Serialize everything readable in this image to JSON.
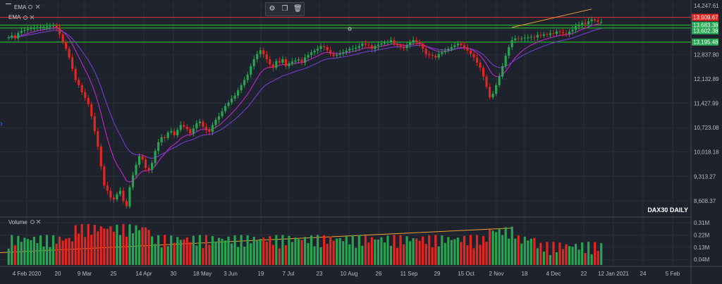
{
  "toolbar": {
    "icons": [
      "series-settings-icon",
      "copy-icon",
      "delete-icon"
    ]
  },
  "indicators": {
    "row1": "EMA",
    "row2": "EMA",
    "volume_label": "Volume"
  },
  "watermark": "DAX30 DAILY",
  "colors": {
    "background": "#1e222d",
    "grid": "#2a2e39",
    "up": "#26a650",
    "down": "#e3261f",
    "ema_fast": "#d226d8",
    "ema_slow": "#7b3fd9",
    "trend": "#f0a030",
    "hline": "#2bd12b",
    "resistance": "#e03535"
  },
  "chart_data": {
    "type": "candlestick",
    "price_axis": {
      "ticks": [
        14247.61,
        13542.82,
        12837.8,
        12132.89,
        11427.99,
        10723.08,
        10018.18,
        9313.27,
        8608.37
      ],
      "tick_labels": [
        "14,247.61",
        "13,542.82",
        "12,837.80",
        "12,132.89",
        "11,427.99",
        "10,723.08",
        "10,018.18",
        "9,313.27",
        "8,608.37"
      ],
      "ylim": [
        8200,
        14350
      ]
    },
    "price_badges": [
      {
        "value": 13909.67,
        "label": "13,909.67",
        "color": "#e3261f"
      },
      {
        "value": 13683.38,
        "label": "13,683.38",
        "color": "#26a650"
      },
      {
        "value": 13602.38,
        "label": "13,602.38",
        "color": "#26a650"
      },
      {
        "value": 13195.48,
        "label": "13,195.48",
        "color": "#26a650"
      }
    ],
    "horizontal_lines": [
      13909.67,
      13683.38,
      13602.38,
      13195.48
    ],
    "x_labels": [
      "4 Feb 2020",
      "20",
      "9 Mar",
      "25",
      "14 Apr",
      "30",
      "18 May",
      "3 Jun",
      "19",
      "7 Jul",
      "23",
      "10 Aug",
      "26",
      "11 Sep",
      "29",
      "15 Oct",
      "2 Nov",
      "18",
      "4 Dec",
      "22",
      "12 Jan 2021",
      "24",
      "5 Feb"
    ],
    "volume_axis": {
      "tick_labels": [
        "0.31M",
        "0.22M",
        "0.13M",
        "0.04M"
      ],
      "ticks": [
        0.31,
        0.22,
        0.13,
        0.04
      ],
      "ylim": [
        0,
        0.33
      ]
    },
    "closes": [
      13330,
      13390,
      13300,
      13460,
      13520,
      13540,
      13570,
      13590,
      13600,
      13620,
      13630,
      13640,
      13650,
      13660,
      13680,
      13610,
      13420,
      13200,
      13000,
      12750,
      12420,
      12100,
      11950,
      11750,
      11580,
      11400,
      11050,
      10620,
      10180,
      9600,
      9050,
      8900,
      8700,
      8650,
      8800,
      8900,
      8600,
      8450,
      9000,
      9350,
      9650,
      9900,
      9800,
      9560,
      9500,
      9700,
      10050,
      10300,
      10450,
      10420,
      10580,
      10620,
      10500,
      10660,
      10800,
      10750,
      10680,
      10550,
      10700,
      10850,
      10900,
      10750,
      10650,
      10600,
      10800,
      10950,
      11050,
      11200,
      11350,
      11450,
      11560,
      11650,
      11800,
      11950,
      12100,
      12250,
      12500,
      12700,
      12850,
      12960,
      12840,
      12700,
      12550,
      12450,
      12650,
      12600,
      12700,
      12500,
      12580,
      12630,
      12660,
      12690,
      12600,
      12750,
      12820,
      12900,
      12950,
      13000,
      13080,
      13050,
      12960,
      12850,
      12800,
      12830,
      12860,
      12900,
      12950,
      13000,
      13000,
      13030,
      13080,
      13150,
      13120,
      13100,
      13000,
      13080,
      13120,
      13150,
      13180,
      13200,
      13250,
      13150,
      13100,
      13050,
      13020,
      13100,
      13200,
      13250,
      13200,
      13150,
      13000,
      12850,
      12820,
      12800,
      12750,
      12850,
      12900,
      12950,
      13000,
      13050,
      13100,
      13150,
      13100,
      13050,
      12950,
      12850,
      12750,
      12600,
      12450,
      12200,
      11900,
      11600,
      11700,
      11950,
      12200,
      12500,
      12800,
      13050,
      13250,
      13300,
      13280,
      13300,
      13320,
      13330,
      13350,
      13330,
      13400,
      13380,
      13420,
      13400,
      13450,
      13430,
      13500,
      13480,
      13450,
      13430,
      13500,
      13550,
      13650,
      13700,
      13750,
      13720,
      13800,
      13850,
      13820,
      13780,
      13780
    ]
  }
}
